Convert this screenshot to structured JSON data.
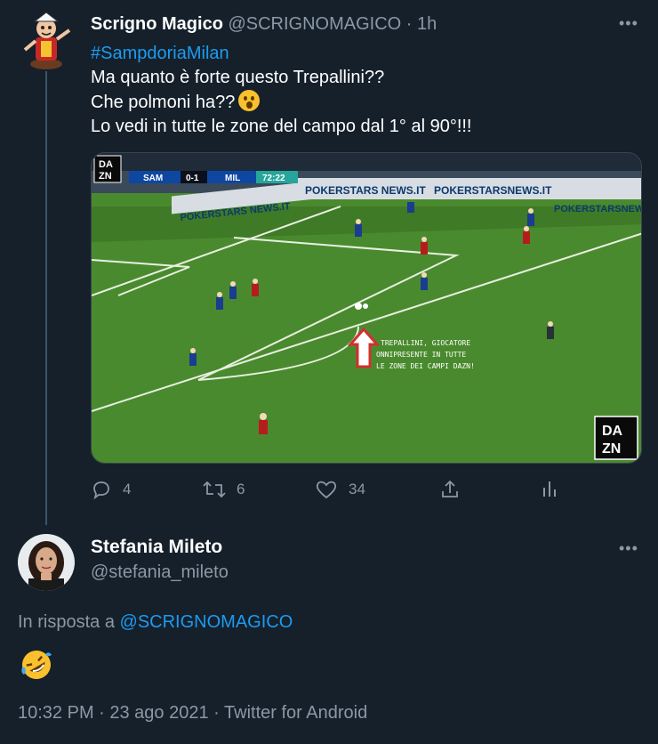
{
  "tweet": {
    "author_name": "Scrigno Magico",
    "author_handle": "@SCRIGNOMAGICO",
    "time": "1h",
    "hashtag": "#SampdoriaMilan",
    "lines": [
      "Ma quanto è forte questo Trepallini??",
      "Che polmoni ha??",
      "Lo vedi in tutte le zone del campo dal 1° al 90°!!!"
    ],
    "media": {
      "logo_top": [
        "DA",
        "ZN"
      ],
      "score_home": "SAM",
      "score": "0-1",
      "score_away": "MIL",
      "clock": "72:22",
      "annotation": [
        "TREPALLINI, GIOCATORE",
        "ONNIPRESENTE IN TUTTE",
        "LE ZONE DEI CAMPI DAZN!"
      ],
      "ads": [
        "POKERSTARS NEWS.IT",
        "POKERSTARSNEWS.IT",
        "POKERSTARSNEWS.IT",
        "POKERSTARS NEWS.IT"
      ]
    },
    "actions": {
      "replies": "4",
      "retweets": "6",
      "likes": "34"
    }
  },
  "reply": {
    "author_name": "Stefania Mileto",
    "author_handle": "@stefania_mileto",
    "in_reply_prefix": "In risposta a",
    "in_reply_handle": "@SCRIGNOMAGICO",
    "emoji_name": "rofl-emoji",
    "timestamp": "10:32 PM · 23 ago 2021 · Twitter for Android"
  },
  "colors": {
    "background": "#15202b",
    "accent": "#1d9bf0",
    "muted": "#8b98a5",
    "pitch": "#4a8a2e"
  }
}
